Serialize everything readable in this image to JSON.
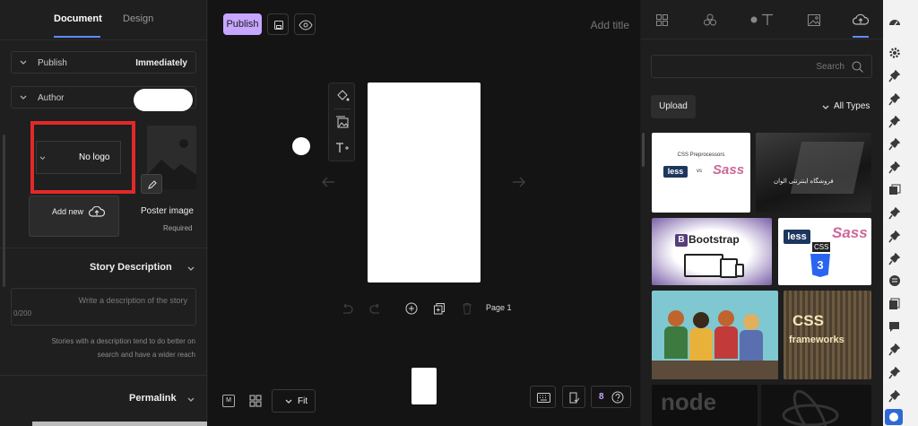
{
  "left": {
    "tabs": {
      "document": "Document",
      "design": "Design"
    },
    "publish": {
      "label": "Publish",
      "value": "Immediately"
    },
    "author": {
      "label": "Author"
    },
    "logo": {
      "text": "No logo",
      "add_new": "Add new"
    },
    "poster": {
      "label": "Poster image",
      "required": "Required"
    },
    "story_description": {
      "heading": "Story Description",
      "placeholder": "Write a description of the story",
      "counter": "0/200",
      "hint_line1": "Stories with a description tend to do better on",
      "hint_line2": "search and have a wider reach"
    },
    "permalink": {
      "heading": "Permalink"
    }
  },
  "toolbar": {
    "publish_label": "Publish",
    "add_title": "Add title"
  },
  "canvas": {
    "page_label": "Page 1"
  },
  "bottom": {
    "zoom": "Fit",
    "help_count": "8"
  },
  "media": {
    "search_placeholder": "Search",
    "upload_label": "Upload",
    "filter_label": "All Types",
    "thumbs": {
      "css_pre_title": "CSS Preprocessors",
      "less": "less",
      "vs": "vs",
      "sass": "Sass",
      "arabic": "فروشگاه اینترنتی الوان",
      "bootstrap": "Bootstrap",
      "css": "CSS",
      "css3": "3",
      "css_frameworks_1": "CSS",
      "css_frameworks_2": "frameworks",
      "node": "node"
    }
  }
}
